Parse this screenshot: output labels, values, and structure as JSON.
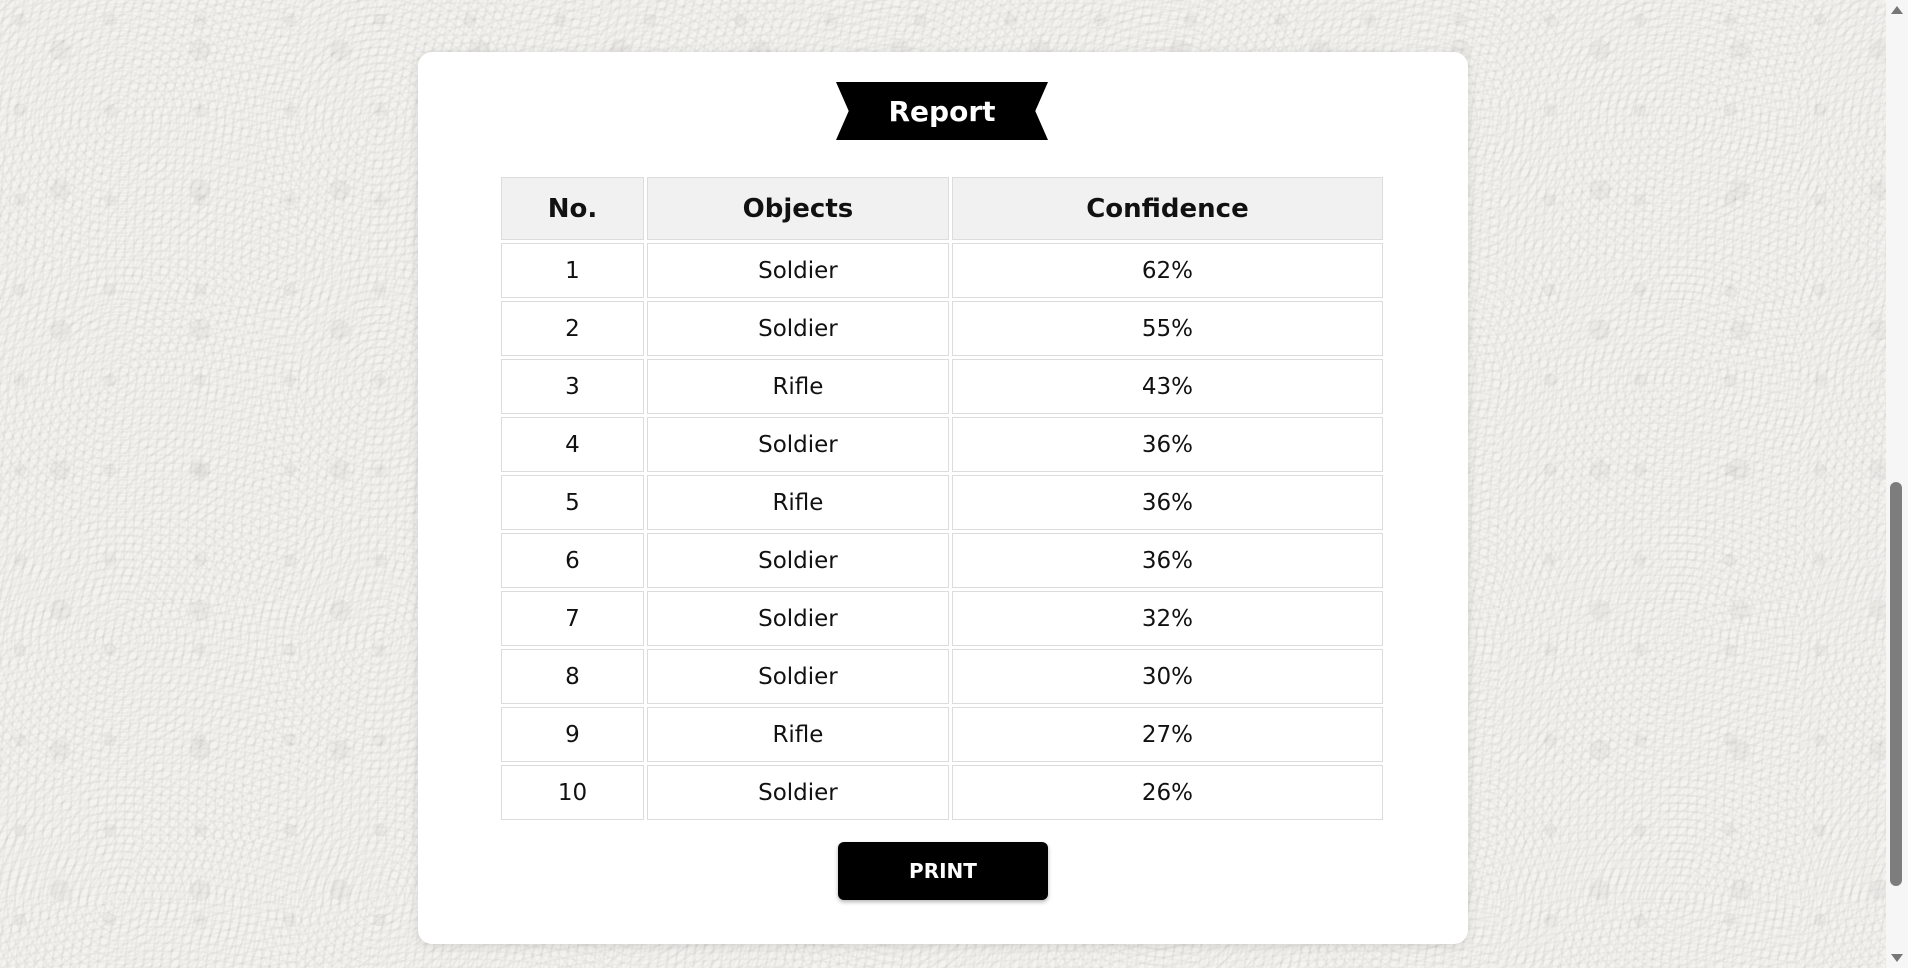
{
  "report": {
    "title": "Report",
    "columns": [
      "No.",
      "Objects",
      "Confidence"
    ],
    "rows": [
      {
        "no": "1",
        "object": "Soldier",
        "confidence": "62%"
      },
      {
        "no": "2",
        "object": "Soldier",
        "confidence": "55%"
      },
      {
        "no": "3",
        "object": "Rifle",
        "confidence": "43%"
      },
      {
        "no": "4",
        "object": "Soldier",
        "confidence": "36%"
      },
      {
        "no": "5",
        "object": "Rifle",
        "confidence": "36%"
      },
      {
        "no": "6",
        "object": "Soldier",
        "confidence": "36%"
      },
      {
        "no": "7",
        "object": "Soldier",
        "confidence": "32%"
      },
      {
        "no": "8",
        "object": "Soldier",
        "confidence": "30%"
      },
      {
        "no": "9",
        "object": "Rifle",
        "confidence": "27%"
      },
      {
        "no": "10",
        "object": "Soldier",
        "confidence": "26%"
      }
    ],
    "print_label": "PRINT"
  },
  "colors": {
    "ribbon": "#000000",
    "button": "#000000",
    "header_bg": "#f1f1f1",
    "page_bg": "#f4f3f0"
  },
  "scrollbar": {
    "position_fraction": 0.6
  }
}
